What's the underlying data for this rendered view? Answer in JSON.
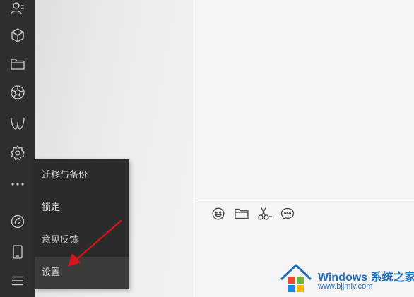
{
  "sidebar": {
    "icons": [
      {
        "name": "contacts-icon"
      },
      {
        "name": "cube-icon"
      },
      {
        "name": "folder-icon"
      },
      {
        "name": "moments-icon"
      },
      {
        "name": "channels-icon"
      },
      {
        "name": "mini-programs-icon"
      },
      {
        "name": "more-icon"
      },
      {
        "name": "search-link-icon"
      },
      {
        "name": "phone-icon"
      },
      {
        "name": "menu-icon"
      }
    ]
  },
  "popup_menu": {
    "items": [
      {
        "label": "迁移与备份"
      },
      {
        "label": "锁定"
      },
      {
        "label": "意见反馈"
      },
      {
        "label": "设置"
      }
    ]
  },
  "toolbar": {
    "icons": [
      "emoji-icon",
      "file-icon",
      "screenshot-icon",
      "chat-history-icon"
    ]
  },
  "colors": {
    "sidebar_bg": "#2e2e2e",
    "menu_bg": "#2b2b2b",
    "arrow": "#d9141a",
    "watermark": "#1f6fbf"
  },
  "watermark": {
    "title": "Windows 系统之家",
    "url": "www.bjjmlv.com"
  }
}
